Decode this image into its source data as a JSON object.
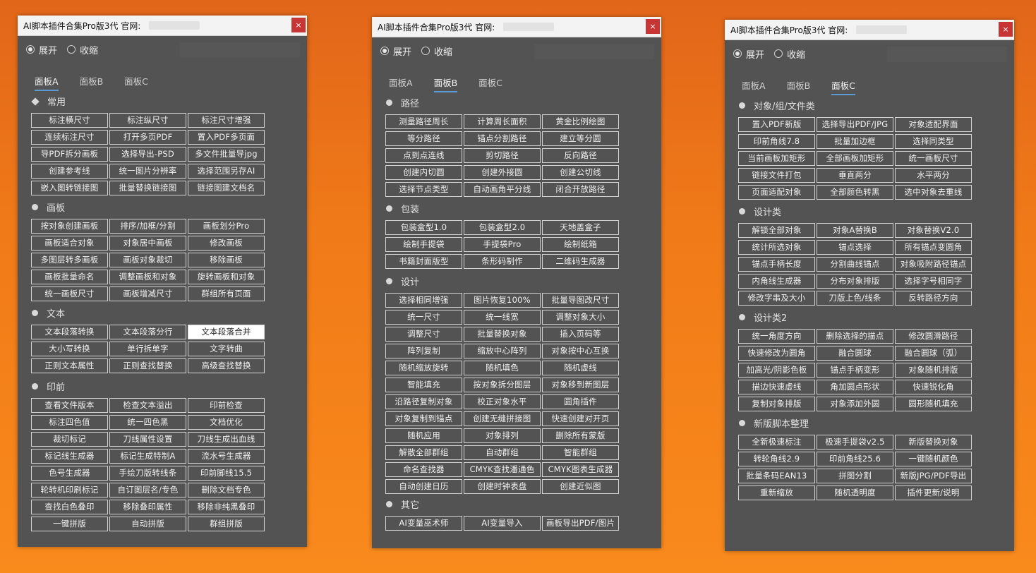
{
  "panels": [
    {
      "title": "AI脚本插件合集Pro版3代 官网:",
      "close_glyph": "×",
      "modes": [
        "展开",
        "收缩"
      ],
      "tabs": [
        "面板A",
        "面板B",
        "面板C"
      ],
      "active_tab": 0,
      "sections": [
        {
          "title": "常用",
          "marker": "diamond",
          "buttons": [
            "标注横尺寸",
            "标注纵尺寸",
            "标注尺寸增强",
            "连续标注尺寸",
            "打开多页PDF",
            "置入PDF多页面",
            "导PDF拆分画板",
            "选择导出-PSD",
            "多文件批量导jpg",
            "创建参考线",
            "统一图片分辨率",
            "选择范围另存AI",
            "嵌入图转链接图",
            "批量替换链接图",
            "链接图建文档名"
          ]
        },
        {
          "title": "画板",
          "marker": "dot",
          "buttons": [
            "按对象创建画板",
            "排序/加框/分割",
            "画板划分Pro",
            "画板适合对象",
            "对象居中画板",
            "修改画板",
            "多图层转多画板",
            "画板对象裁切",
            "移除画板",
            "画板批量命名",
            "调整画板和对象",
            "旋转画板和对象",
            "统一画板尺寸",
            "画板增减尺寸",
            "群组所有页面"
          ]
        },
        {
          "title": "文本",
          "marker": "dot",
          "buttons": [
            "文本段落转换",
            "文本段落分行",
            "文本段落合并",
            "大小写转换",
            "单行拆单字",
            "文字转曲",
            "正则文本属性",
            "正则查找替换",
            "高级查找替换"
          ],
          "highlight": "文本段落合并"
        },
        {
          "title": "印前",
          "marker": "dot",
          "buttons": [
            "查看文件版本",
            "检查文本溢出",
            "印前检查",
            "标注四色值",
            "统一四色黑",
            "文档优化",
            "裁切标记",
            "刀线属性设置",
            "刀线生成出血线",
            "标记线生成器",
            "标记生成特制A",
            "流水号生成器",
            "色号生成器",
            "手绘刀版转线条",
            "印前脚线15.5",
            "轮转机印刷标记",
            "自订图层名/专色",
            "删除文档专色",
            "查找白色叠印",
            "移除叠印属性",
            "移除非纯黑叠印",
            "一键拼版",
            "自动拼版",
            "群组拼版"
          ]
        }
      ]
    },
    {
      "title": "AI脚本插件合集Pro版3代 官网:",
      "close_glyph": "×",
      "modes": [
        "展开",
        "收缩"
      ],
      "tabs": [
        "面板A",
        "面板B",
        "面板C"
      ],
      "active_tab": 1,
      "sections": [
        {
          "title": "路径",
          "marker": "dot",
          "buttons": [
            "测量路径周长",
            "计算周长面积",
            "黄金比例绘图",
            "等分路径",
            "锚点分割路径",
            "建立等分圆",
            "点到点连线",
            "剪切路径",
            "反向路径",
            "创建内切圆",
            "创建外接圆",
            "创建公切线",
            "选择节点类型",
            "自动画角平分线",
            "闭合开放路径"
          ]
        },
        {
          "title": "包装",
          "marker": "dot",
          "buttons": [
            "包装盒型1.0",
            "包装盒型2.0",
            "天地盖盒子",
            "绘制手提袋",
            "手提袋Pro",
            "绘制纸箱",
            "书籍封面版型",
            "条形码制作",
            "二维码生成器"
          ]
        },
        {
          "title": "设计",
          "marker": "dot",
          "buttons": [
            "选择相同增强",
            "图片恢复100%",
            "批量导图改尺寸",
            "统一尺寸",
            "统一线宽",
            "调整对象大小",
            "调整尺寸",
            "批量替换对象",
            "插入页码等",
            "阵列复制",
            "缩放中心阵列",
            "对象按中心互换",
            "随机缩放旋转",
            "随机填色",
            "随机虚线",
            "智能填充",
            "按对象拆分图层",
            "对象移到新图层",
            "沿路径复制对象",
            "校正对象水平",
            "圆角插件",
            "对象复制到锚点",
            "创建无缝拼接图",
            "快速创建对开页",
            "随机应用",
            "对象排列",
            "删除所有蒙版",
            "解散全部群组",
            "自动群组",
            "智能群组",
            "命名查找器",
            "CMYK查找潘通色",
            "CMYK图表生成器",
            "自动创建日历",
            "创建时钟表盘",
            "创建近似图"
          ]
        },
        {
          "title": "其它",
          "marker": "dot",
          "buttons": [
            "AI变量巫术师",
            "AI变量导入",
            "画板导出PDF/图片"
          ]
        }
      ]
    },
    {
      "title": "AI脚本插件合集Pro版3代 官网:",
      "close_glyph": "×",
      "modes": [
        "展开",
        "收缩"
      ],
      "tabs": [
        "面板A",
        "面板B",
        "面板C"
      ],
      "active_tab": 2,
      "sections": [
        {
          "title": "对象/组/文件类",
          "marker": "dot",
          "buttons": [
            "置入PDF新版",
            "选择导出PDF/JPG",
            "对象适配界面",
            "印前角线7.8",
            "批量加边框",
            "选择同类型",
            "当前画板加矩形",
            "全部画板加矩形",
            "统一画板尺寸",
            "链接文件打包",
            "垂直两分",
            "水平两分",
            "页面适配对象",
            "全部颜色转黑",
            "选中对象去重线"
          ]
        },
        {
          "title": "设计类",
          "marker": "dot",
          "buttons": [
            "解锁全部对象",
            "对象A替换B",
            "对象替换V2.0",
            "统计所选对象",
            "锚点选择",
            "所有锚点变圆角",
            "锚点手柄长度",
            "分割曲线锚点",
            "对象吸附路径锚点",
            "内角线生成器",
            "分布对象排版",
            "选择字号相同字",
            "修改字串及大小",
            "刀版上色/线条",
            "反转路径方向"
          ]
        },
        {
          "title": "设计类2",
          "marker": "dot",
          "buttons": [
            "统一角度方向",
            "删除选择的描点",
            "修改圆滑路径",
            "快速修改为圆角",
            "融合圆球",
            "融合圆球（弧）",
            "加高光/阴影色板",
            "锚点手柄变形",
            "对象随机排版",
            "描边快速虚线",
            "角加圆点形状",
            "快速锐化角",
            "复制对象排版",
            "对象添加外圆",
            "圆形随机填充"
          ]
        },
        {
          "title": "新版脚本整理",
          "marker": "dot",
          "buttons": [
            "全新极速标注",
            "极速手提袋v2.5",
            "新版替换对象",
            "转轮角线2.9",
            "印前角线25.6",
            "一键随机颜色",
            "批量条码EAN13",
            "拼图分割",
            "新版JPG/PDF导出",
            "重新缩放",
            "随机透明度",
            "插件更新/说明"
          ]
        }
      ]
    }
  ]
}
